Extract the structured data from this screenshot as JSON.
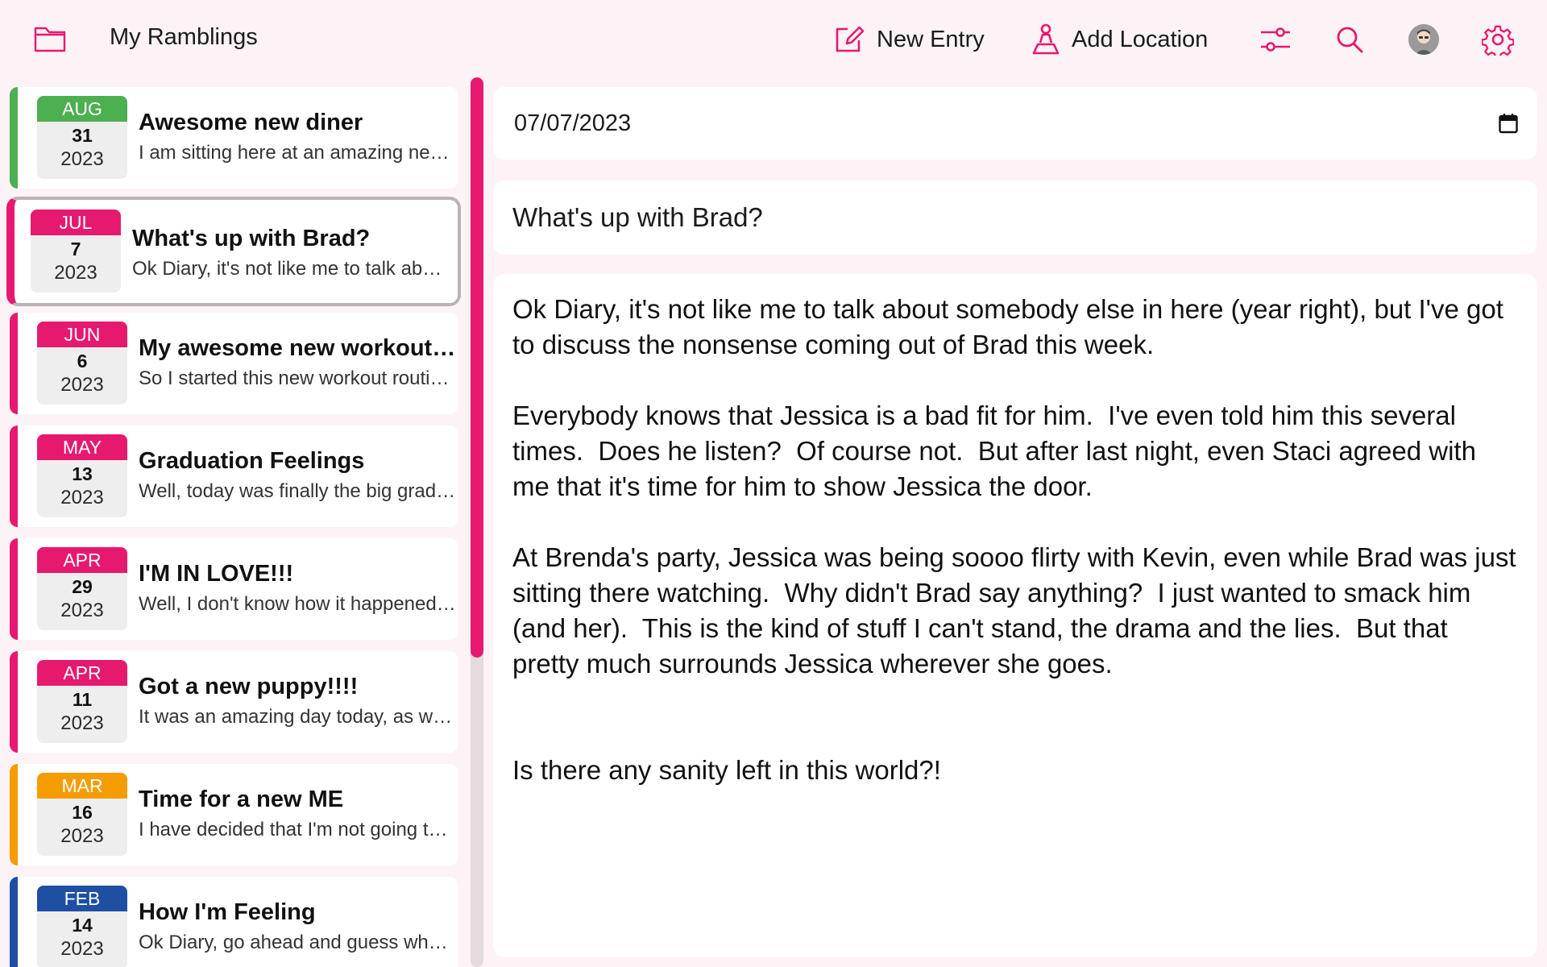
{
  "app": {
    "title": "My Ramblings"
  },
  "toolbar": {
    "folder_icon": "folder-icon",
    "new_entry_label": "New Entry",
    "add_location_label": "Add Location",
    "filter_icon": "sliders-icon",
    "search_icon": "search-icon",
    "avatar_icon": "avatar",
    "settings_icon": "gear-icon",
    "accent_color": "#e6196f"
  },
  "entries": [
    {
      "month": "AUG",
      "day": "31",
      "year": "2023",
      "title": "Awesome new diner",
      "preview": "I am sitting here at an amazing new diner that just opened up",
      "color": "#4caf50",
      "selected": false
    },
    {
      "month": "JUL",
      "day": "7",
      "year": "2023",
      "title": "What's up with Brad?",
      "preview": "Ok Diary, it's not like me to talk about somebody else in here",
      "color": "#e6196f",
      "selected": true
    },
    {
      "month": "JUN",
      "day": "6",
      "year": "2023",
      "title": "My awesome new workout routine",
      "preview": "So I started this new workout routine this week",
      "color": "#e6196f",
      "selected": false
    },
    {
      "month": "MAY",
      "day": "13",
      "year": "2023",
      "title": "Graduation Feelings",
      "preview": "Well, today was finally the big graduation day",
      "color": "#e6196f",
      "selected": false
    },
    {
      "month": "APR",
      "day": "29",
      "year": "2023",
      "title": "I'M IN LOVE!!!",
      "preview": "Well, I don't know how it happened but it did",
      "color": "#e6196f",
      "selected": false
    },
    {
      "month": "APR",
      "day": "11",
      "year": "2023",
      "title": "Got a new puppy!!!!",
      "preview": "It was an amazing day today, as we brought home our new puppy",
      "color": "#e6196f",
      "selected": false
    },
    {
      "month": "MAR",
      "day": "16",
      "year": "2023",
      "title": "Time for a new ME",
      "preview": "I have decided that I'm not going to be the same person anymore",
      "color": "#f59c00",
      "selected": false
    },
    {
      "month": "FEB",
      "day": "14",
      "year": "2023",
      "title": "How I'm Feeling",
      "preview": "Ok Diary, go ahead and guess what day it is",
      "color": "#1f4fa3",
      "selected": false
    }
  ],
  "editor": {
    "date_value": "07/07/2023",
    "calendar_icon": "calendar-icon",
    "title": "What's up with Brad?",
    "body": "Ok Diary, it's not like me to talk about somebody else in here (year right), but I've got to discuss the nonsense coming out of Brad this week.\n\nEverybody knows that Jessica is a bad fit for him.  I've even told him this several times.  Does he listen?  Of course not.  But after last night, even Staci agreed with me that it's time for him to show Jessica the door.\n\nAt Brenda's party, Jessica was being soooo flirty with Kevin, even while Brad was just sitting there watching.  Why didn't Brad say anything?  I just wanted to smack him (and her).  This is the kind of stuff I can't stand, the drama and the lies.  But that pretty much surrounds Jessica wherever she goes.\n\n\nIs there any sanity left in this world?!"
  }
}
